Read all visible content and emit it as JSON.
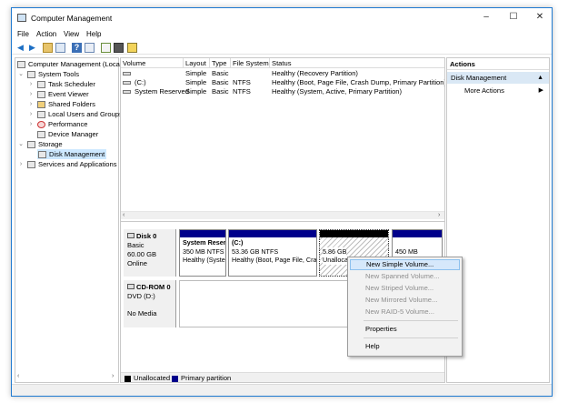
{
  "window": {
    "title": "Computer Management",
    "controls": [
      "–",
      "☐",
      "✕"
    ]
  },
  "menu": [
    "File",
    "Action",
    "View",
    "Help"
  ],
  "toolbar": [
    "back-icon",
    "forward-icon",
    "up-icon",
    "properties-icon",
    "help-icon",
    "console-icon",
    "export-icon",
    "settings-icon"
  ],
  "tree": {
    "root": "Computer Management (Local",
    "system_tools": "System Tools",
    "task_scheduler": "Task Scheduler",
    "event_viewer": "Event Viewer",
    "shared_folders": "Shared Folders",
    "local_users": "Local Users and Groups",
    "performance": "Performance",
    "device_manager": "Device Manager",
    "storage": "Storage",
    "disk_management": "Disk Management",
    "services": "Services and Applications"
  },
  "volumes": {
    "headers": [
      "Volume",
      "Layout",
      "Type",
      "File System",
      "Status"
    ],
    "rows": [
      {
        "volume": "",
        "layout": "Simple",
        "type": "Basic",
        "fs": "",
        "status": "Healthy (Recovery Partition)"
      },
      {
        "volume": "(C:)",
        "layout": "Simple",
        "type": "Basic",
        "fs": "NTFS",
        "status": "Healthy (Boot, Page File, Crash Dump, Primary Partition)"
      },
      {
        "volume": "System Reserved",
        "layout": "Simple",
        "type": "Basic",
        "fs": "NTFS",
        "status": "Healthy (System, Active, Primary Partition)"
      }
    ]
  },
  "disk0": {
    "name": "Disk 0",
    "type": "Basic",
    "size": "60.00 GB",
    "state": "Online",
    "partitions": [
      {
        "name": "System Reser",
        "size": "350 MB NTFS",
        "status": "Healthy (Syste"
      },
      {
        "name": "(C:)",
        "size": "53.36 GB NTFS",
        "status": "Healthy (Boot, Page File, Cra"
      },
      {
        "name": "",
        "size": "5.86 GB",
        "status": "Unalloca"
      },
      {
        "name": "",
        "size": "450 MB",
        "status": ""
      }
    ]
  },
  "cdrom0": {
    "name": "CD-ROM 0",
    "type": "DVD (D:)",
    "state": "No Media"
  },
  "legend": {
    "unallocated": "Unallocated",
    "primary": "Primary partition"
  },
  "actions": {
    "header": "Actions",
    "section": "Disk Management",
    "more": "More Actions"
  },
  "context_menu": {
    "new_simple": "New Simple Volume...",
    "new_spanned": "New Spanned Volume...",
    "new_striped": "New Striped Volume...",
    "new_mirrored": "New Mirrored Volume...",
    "new_raid5": "New RAID-5 Volume...",
    "properties": "Properties",
    "help": "Help"
  },
  "colors": {
    "primary_partition": "#00008b",
    "unallocated": "#000000",
    "selection": "#cde8ff",
    "action_section": "#dae8f5"
  }
}
